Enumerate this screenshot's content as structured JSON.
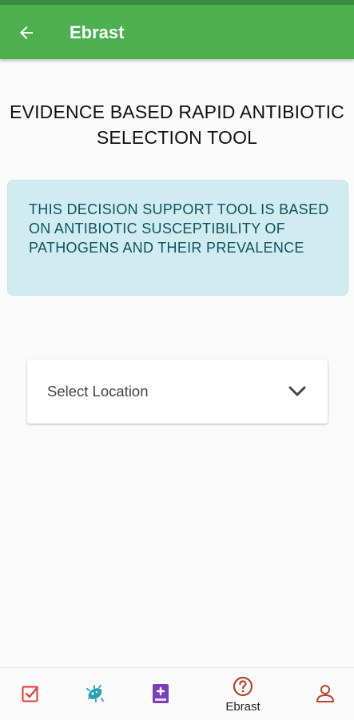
{
  "app_bar": {
    "title": "Ebrast",
    "back_icon": "arrow-left-icon"
  },
  "main": {
    "heading": "EVIDENCE BASED RAPID ANTIBIOTIC SELECTION TOOL",
    "info_text": "THIS DECISION SUPPORT TOOL IS BASED ON ANTIBIOTIC SUSCEPTIBILITY OF PATHOGENS AND THEIR PREVALENCE",
    "location_select": {
      "selected": "Select Location",
      "icon": "chevron-down-icon"
    }
  },
  "bottom_nav": {
    "items": [
      {
        "icon": "checkbox-icon",
        "label": "",
        "color": "#e53935"
      },
      {
        "icon": "bacteria-icon",
        "label": "",
        "color": "#26a0b8"
      },
      {
        "icon": "medical-book-icon",
        "label": "",
        "color": "#7b3fb8"
      },
      {
        "icon": "help-circle-icon",
        "label": "Ebrast",
        "color": "#b5462c",
        "active": true
      },
      {
        "icon": "user-icon",
        "label": "",
        "color": "#b5462c"
      }
    ]
  },
  "colors": {
    "app_bar": "#4caf50",
    "info_bg": "#d1ecf1",
    "info_text": "#0c5460"
  }
}
